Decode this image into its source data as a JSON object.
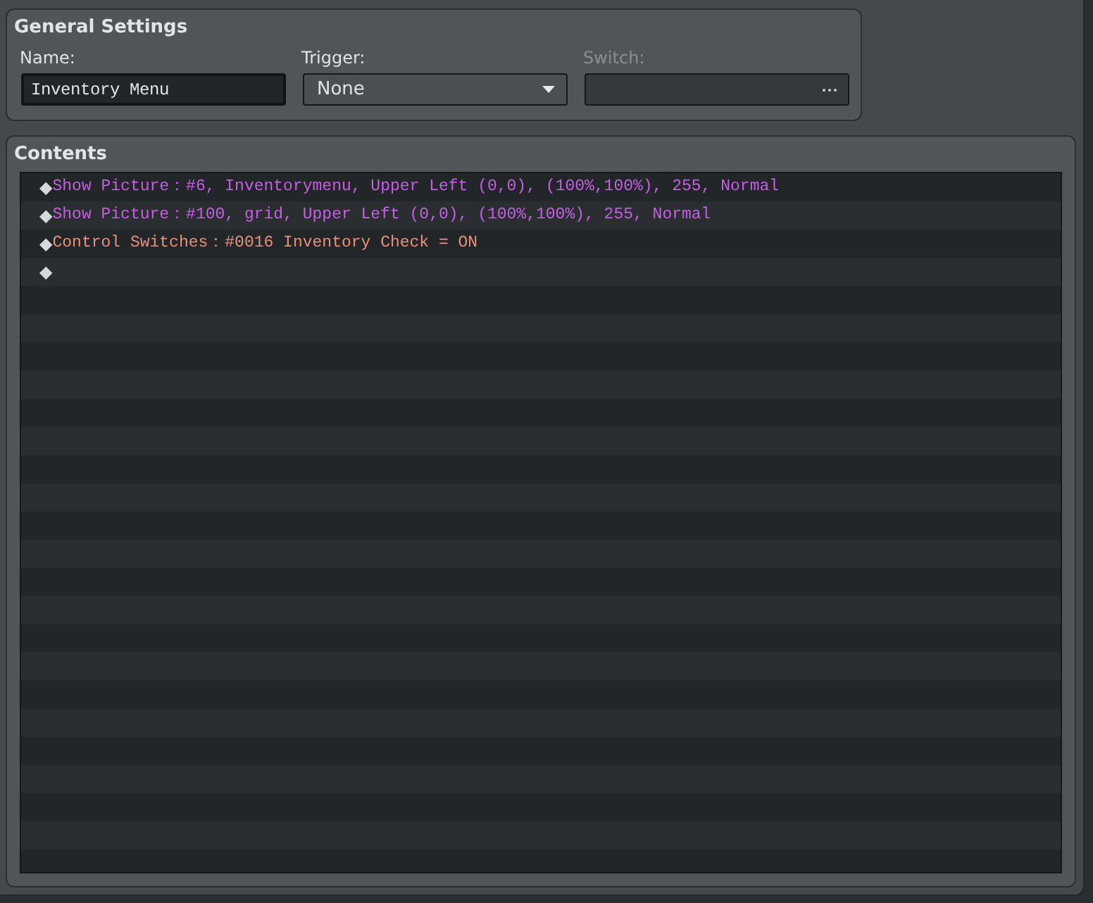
{
  "general_settings": {
    "title": "General Settings",
    "fields": [
      {
        "kind": "text",
        "label": "Name:",
        "value": "Inventory Menu",
        "disabled": false
      },
      {
        "kind": "dropdown",
        "label": "Trigger:",
        "value": "None",
        "disabled": false
      },
      {
        "kind": "picker",
        "label": "Switch:",
        "disabled": true
      }
    ]
  },
  "contents": {
    "title": "Contents",
    "commands": [
      {
        "marker": "◆",
        "text": "Show Picture：#6, Inventorymenu, Upper Left (0,0), (100%,100%), 255, Normal",
        "color": "#c75ee6"
      },
      {
        "marker": "◆",
        "text": "Show Picture：#100, grid, Upper Left (0,0), (100%,100%), 255, Normal",
        "color": "#c75ee6"
      },
      {
        "marker": "◆",
        "text": "Control Switches：#0016 Inventory Check = ON",
        "color": "#e8917a"
      },
      {
        "marker": "◆"
      }
    ]
  }
}
